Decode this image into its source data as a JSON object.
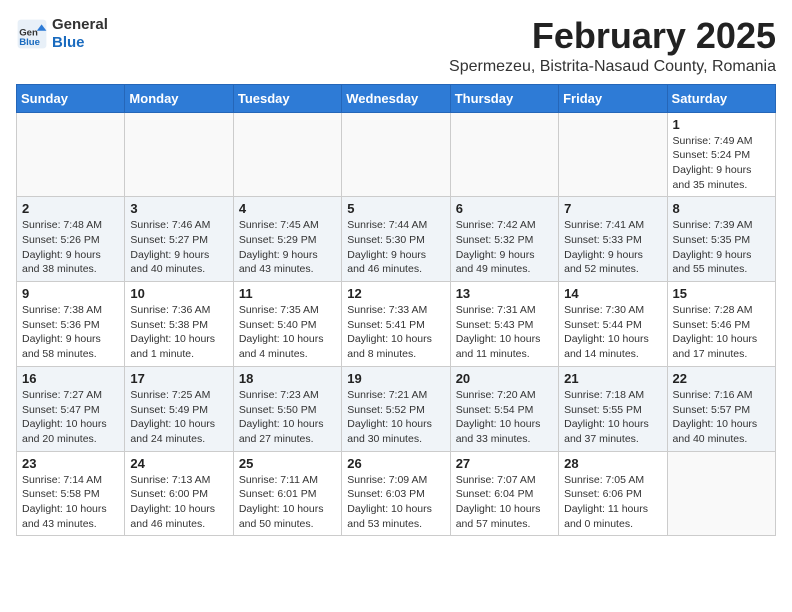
{
  "header": {
    "logo_general": "General",
    "logo_blue": "Blue",
    "month_year": "February 2025",
    "location": "Spermezeu, Bistrita-Nasaud County, Romania"
  },
  "days_of_week": [
    "Sunday",
    "Monday",
    "Tuesday",
    "Wednesday",
    "Thursday",
    "Friday",
    "Saturday"
  ],
  "weeks": [
    {
      "days": [
        {
          "number": "",
          "info": ""
        },
        {
          "number": "",
          "info": ""
        },
        {
          "number": "",
          "info": ""
        },
        {
          "number": "",
          "info": ""
        },
        {
          "number": "",
          "info": ""
        },
        {
          "number": "",
          "info": ""
        },
        {
          "number": "1",
          "info": "Sunrise: 7:49 AM\nSunset: 5:24 PM\nDaylight: 9 hours\nand 35 minutes."
        }
      ]
    },
    {
      "days": [
        {
          "number": "2",
          "info": "Sunrise: 7:48 AM\nSunset: 5:26 PM\nDaylight: 9 hours\nand 38 minutes."
        },
        {
          "number": "3",
          "info": "Sunrise: 7:46 AM\nSunset: 5:27 PM\nDaylight: 9 hours\nand 40 minutes."
        },
        {
          "number": "4",
          "info": "Sunrise: 7:45 AM\nSunset: 5:29 PM\nDaylight: 9 hours\nand 43 minutes."
        },
        {
          "number": "5",
          "info": "Sunrise: 7:44 AM\nSunset: 5:30 PM\nDaylight: 9 hours\nand 46 minutes."
        },
        {
          "number": "6",
          "info": "Sunrise: 7:42 AM\nSunset: 5:32 PM\nDaylight: 9 hours\nand 49 minutes."
        },
        {
          "number": "7",
          "info": "Sunrise: 7:41 AM\nSunset: 5:33 PM\nDaylight: 9 hours\nand 52 minutes."
        },
        {
          "number": "8",
          "info": "Sunrise: 7:39 AM\nSunset: 5:35 PM\nDaylight: 9 hours\nand 55 minutes."
        }
      ]
    },
    {
      "days": [
        {
          "number": "9",
          "info": "Sunrise: 7:38 AM\nSunset: 5:36 PM\nDaylight: 9 hours\nand 58 minutes."
        },
        {
          "number": "10",
          "info": "Sunrise: 7:36 AM\nSunset: 5:38 PM\nDaylight: 10 hours\nand 1 minute."
        },
        {
          "number": "11",
          "info": "Sunrise: 7:35 AM\nSunset: 5:40 PM\nDaylight: 10 hours\nand 4 minutes."
        },
        {
          "number": "12",
          "info": "Sunrise: 7:33 AM\nSunset: 5:41 PM\nDaylight: 10 hours\nand 8 minutes."
        },
        {
          "number": "13",
          "info": "Sunrise: 7:31 AM\nSunset: 5:43 PM\nDaylight: 10 hours\nand 11 minutes."
        },
        {
          "number": "14",
          "info": "Sunrise: 7:30 AM\nSunset: 5:44 PM\nDaylight: 10 hours\nand 14 minutes."
        },
        {
          "number": "15",
          "info": "Sunrise: 7:28 AM\nSunset: 5:46 PM\nDaylight: 10 hours\nand 17 minutes."
        }
      ]
    },
    {
      "days": [
        {
          "number": "16",
          "info": "Sunrise: 7:27 AM\nSunset: 5:47 PM\nDaylight: 10 hours\nand 20 minutes."
        },
        {
          "number": "17",
          "info": "Sunrise: 7:25 AM\nSunset: 5:49 PM\nDaylight: 10 hours\nand 24 minutes."
        },
        {
          "number": "18",
          "info": "Sunrise: 7:23 AM\nSunset: 5:50 PM\nDaylight: 10 hours\nand 27 minutes."
        },
        {
          "number": "19",
          "info": "Sunrise: 7:21 AM\nSunset: 5:52 PM\nDaylight: 10 hours\nand 30 minutes."
        },
        {
          "number": "20",
          "info": "Sunrise: 7:20 AM\nSunset: 5:54 PM\nDaylight: 10 hours\nand 33 minutes."
        },
        {
          "number": "21",
          "info": "Sunrise: 7:18 AM\nSunset: 5:55 PM\nDaylight: 10 hours\nand 37 minutes."
        },
        {
          "number": "22",
          "info": "Sunrise: 7:16 AM\nSunset: 5:57 PM\nDaylight: 10 hours\nand 40 minutes."
        }
      ]
    },
    {
      "days": [
        {
          "number": "23",
          "info": "Sunrise: 7:14 AM\nSunset: 5:58 PM\nDaylight: 10 hours\nand 43 minutes."
        },
        {
          "number": "24",
          "info": "Sunrise: 7:13 AM\nSunset: 6:00 PM\nDaylight: 10 hours\nand 46 minutes."
        },
        {
          "number": "25",
          "info": "Sunrise: 7:11 AM\nSunset: 6:01 PM\nDaylight: 10 hours\nand 50 minutes."
        },
        {
          "number": "26",
          "info": "Sunrise: 7:09 AM\nSunset: 6:03 PM\nDaylight: 10 hours\nand 53 minutes."
        },
        {
          "number": "27",
          "info": "Sunrise: 7:07 AM\nSunset: 6:04 PM\nDaylight: 10 hours\nand 57 minutes."
        },
        {
          "number": "28",
          "info": "Sunrise: 7:05 AM\nSunset: 6:06 PM\nDaylight: 11 hours\nand 0 minutes."
        },
        {
          "number": "",
          "info": ""
        }
      ]
    }
  ]
}
